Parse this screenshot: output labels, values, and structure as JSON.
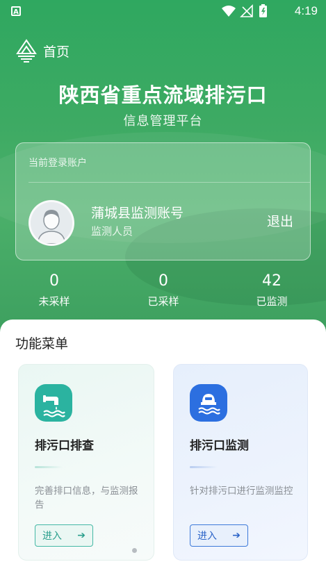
{
  "status_bar": {
    "time": "4:19"
  },
  "header": {
    "title": "首页"
  },
  "hero": {
    "title": "陕西省重点流域排污口",
    "subtitle": "信息管理平台"
  },
  "account": {
    "label": "当前登录账户",
    "name": "蒲城县监测账号",
    "role": "监测人员",
    "logout_label": "退出"
  },
  "stats": [
    {
      "value": "0",
      "label": "未采样"
    },
    {
      "value": "0",
      "label": "已采样"
    },
    {
      "value": "42",
      "label": "已监测"
    }
  ],
  "menu": {
    "title": "功能菜单",
    "cards": [
      {
        "title": "排污口排查",
        "desc": "完善排口信息，与监测报告",
        "button": "进入",
        "icon": "outfall-pipe-icon",
        "color": "#2bb3a0"
      },
      {
        "title": "排污口监测",
        "desc": "针对排污口进行监测监控",
        "button": "进入",
        "icon": "monitoring-station-icon",
        "color": "#2c6fe0"
      }
    ]
  },
  "colors": {
    "hero_green": "#3daa63",
    "teal": "#2bb3a0",
    "blue": "#2c6fe0"
  }
}
